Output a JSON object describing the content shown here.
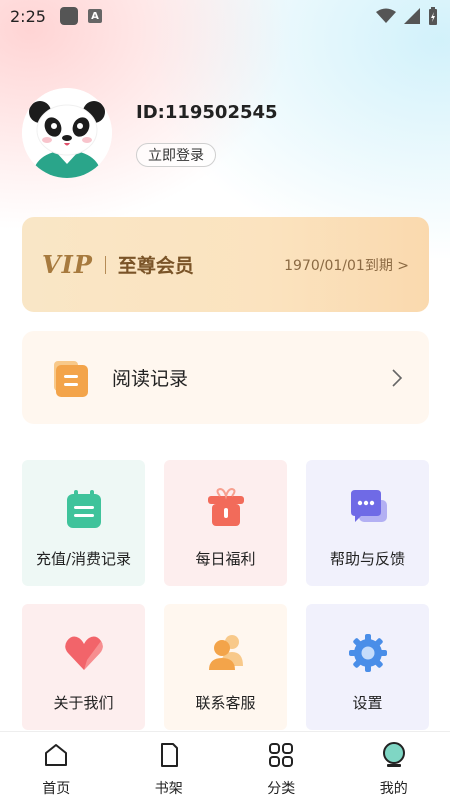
{
  "status_bar": {
    "time": "2:25",
    "a_icon": "A"
  },
  "profile": {
    "user_id": "ID:119502545",
    "login_label": "立即登录"
  },
  "vip": {
    "logo": "VIP",
    "title": "至尊会员",
    "expire": "1970/01/01到期 >"
  },
  "reading_record": {
    "label": "阅读记录"
  },
  "grid": [
    {
      "label": "充值/消费记录",
      "icon": "receipt-icon",
      "bg": "#eef8f5"
    },
    {
      "label": "每日福利",
      "icon": "gift-icon",
      "bg": "#fdeeee"
    },
    {
      "label": "帮助与反馈",
      "icon": "chat-bubble-icon",
      "bg": "#f1f1fc"
    },
    {
      "label": "关于我们",
      "icon": "heart-icon",
      "bg": "#fdeeee"
    },
    {
      "label": "联系客服",
      "icon": "people-icon",
      "bg": "#fff7ef"
    },
    {
      "label": "设置",
      "icon": "gear-icon",
      "bg": "#f1f1fc"
    }
  ],
  "nav": [
    {
      "label": "首页",
      "icon": "home-icon"
    },
    {
      "label": "书架",
      "icon": "bookshelf-icon"
    },
    {
      "label": "分类",
      "icon": "category-grid-icon"
    },
    {
      "label": "我的",
      "icon": "profile-globe-icon",
      "active": true
    }
  ],
  "colors": {
    "vip_gold": "#a77a3e",
    "accent_teal": "#2aa58a",
    "record_orange": "#f3a44a"
  }
}
